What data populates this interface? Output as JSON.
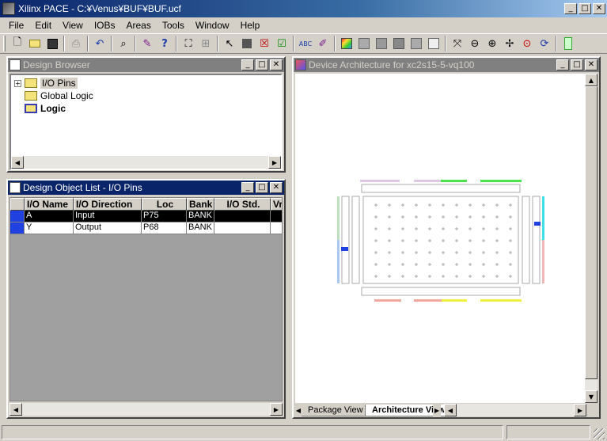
{
  "window": {
    "title": "Xilinx PACE - C:¥Venus¥BUF¥BUF.ucf"
  },
  "menu": [
    "File",
    "Edit",
    "View",
    "IOBs",
    "Areas",
    "Tools",
    "Window",
    "Help"
  ],
  "toolbar": {
    "icons": [
      "new-file-icon",
      "open-folder-icon",
      "save-icon",
      "print-icon",
      "undo-icon",
      "find-icon",
      "wrench-icon",
      "help-pointer-icon",
      "zoom-area-icon",
      "select-area-icon",
      "pointer-icon",
      "stop-icon",
      "cancel-icon",
      "check-icon",
      "abc-icon",
      "pen-icon",
      "color-palette-icon",
      "pattern-icon",
      "gray-box-icon",
      "gray-box2-icon",
      "gray-box3-icon",
      "white-box-icon",
      "zoom-fit-icon",
      "zoom-out-icon",
      "zoom-in-icon",
      "zoom-full-icon",
      "find-zoom-icon",
      "refresh-icon"
    ]
  },
  "design_browser": {
    "title": "Design Browser",
    "tree": [
      {
        "label": "I/O Pins",
        "expandable": true,
        "selected": true
      },
      {
        "label": "Global Logic",
        "expandable": false,
        "selected": false
      },
      {
        "label": "Logic",
        "expandable": false,
        "selected": false,
        "bold": true
      }
    ]
  },
  "object_list": {
    "title": "Design Object List - I/O Pins",
    "columns": [
      "I/O Name",
      "I/O Direction",
      "Loc",
      "Bank",
      "I/O Std.",
      "Vr"
    ],
    "rows": [
      {
        "name": "A",
        "direction": "Input",
        "loc": "P75",
        "bank": "BANK",
        "std": "",
        "vr": "",
        "selected": true
      },
      {
        "name": "Y",
        "direction": "Output",
        "loc": "P68",
        "bank": "BANK",
        "std": "",
        "vr": "",
        "selected": false
      }
    ]
  },
  "device_view": {
    "title": "Device Architecture for xc2s15-5-vq100",
    "tabs": [
      "Package View",
      "Architecture View"
    ],
    "active_tab": "Architecture View"
  },
  "colors": {
    "title_active": "#0a246a",
    "title_inactive": "#808080",
    "selection": "#000000",
    "io_marker": "#2040e0"
  }
}
